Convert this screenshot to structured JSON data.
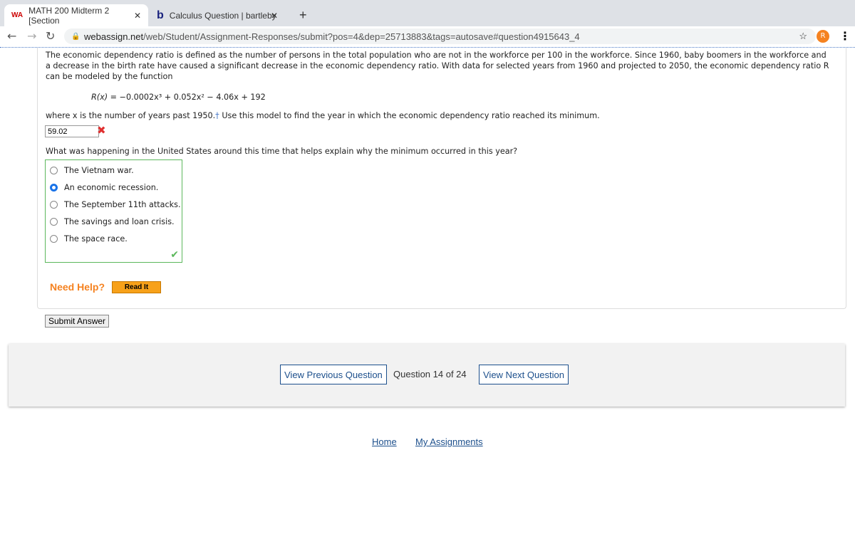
{
  "browser": {
    "tabs": [
      {
        "label": "MATH 200 Midterm 2 [Section",
        "icon": "webassign-icon"
      },
      {
        "label": "Calculus Question | bartleby",
        "icon": "bartleby-icon"
      }
    ],
    "url_host": "webassign.net",
    "url_path": "/web/Student/Assignment-Responses/submit?pos=4&dep=25713883&tags=autosave#question4915643_4",
    "profile": "R"
  },
  "question": {
    "intro": "The economic dependency ratio is defined as the number of persons in the total population who are not in the workforce per 100 in the workforce. Since 1960, baby boomers in the workforce and a decrease in the birth rate have caused a significant decrease in the economic dependency ratio. With data for selected years from 1960 and projected to 2050, the economic dependency ratio R can be modeled by the function",
    "formula_lhs": "R(x) = ",
    "formula_rhs": "−0.0002x³ + 0.052x² − 4.06x + 192",
    "prompt1": "where x is the number of years past 1950.",
    "dagger": "†",
    "prompt1b": " Use this model to find the year in which the economic dependency ratio reached its minimum.",
    "answer": "59.02",
    "answer_status": "incorrect",
    "prompt2": "What was happening in the United States around this time that helps explain why the minimum occurred in this year?",
    "choices": [
      "The Vietnam war.",
      "An economic recession.",
      "The September 11th attacks.",
      "The savings and loan crisis.",
      "The space race."
    ],
    "selected": 1,
    "choice_status": "correct",
    "need_help": "Need Help?",
    "read_it": "Read It",
    "submit": "Submit Answer"
  },
  "qnav": {
    "prev": "View Previous Question",
    "position": "Question 14 of 24",
    "next": "View Next Question"
  },
  "footer": {
    "home": "Home",
    "assignments": "My Assignments"
  }
}
